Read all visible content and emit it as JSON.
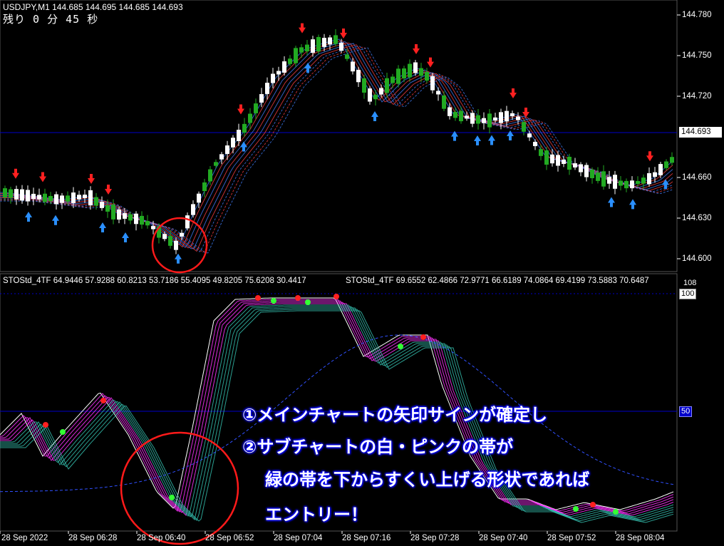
{
  "header": {
    "symbol_text": "USDJPY,M1  144.685 144.695 144.685 144.693",
    "remaining_text": "残り 0 分 45 秒"
  },
  "price_axis": {
    "ticks": [
      "144.780",
      "144.750",
      "144.720",
      "144.693",
      "144.660",
      "144.630",
      "144.600"
    ],
    "current_price": "144.693"
  },
  "indicator": {
    "label_left": "STOStd_4TF 64.9446 57.9288 60.8213 53.7186 55.4095 49.8205 75.6208 30.4417",
    "label_right": "STOStd_4TF 69.6552 62.4866 72.9771 66.6189 74.0864 69.4199 73.5883 70.6487",
    "level_top": "108",
    "level_100": "100",
    "level_50": "50"
  },
  "time_axis": {
    "labels": [
      "28 Sep 2022",
      "28 Sep 06:28",
      "28 Sep 06:40",
      "28 Sep 06:52",
      "28 Sep 07:04",
      "28 Sep 07:16",
      "28 Sep 07:28",
      "28 Sep 07:40",
      "28 Sep 07:52",
      "28 Sep 08:04"
    ]
  },
  "annotations": {
    "line1": "①メインチャートの矢印サインが確定し",
    "line2": "②サブチャートの白・ピンクの帯が",
    "line3": "緑の帯を下からすくい上げる形状であれば",
    "line4": "エントリー！"
  },
  "colors": {
    "background": "#000000",
    "bull_candle": "#22aa22",
    "bear_candle": "#ffffff",
    "sell_arrow": "#ff2020",
    "buy_arrow": "#2a8fff",
    "grid_line": "#0000c8",
    "highlight_circle": "#ff1a1a",
    "oscillator_fast": "#ff33ff",
    "oscillator_slow": "#33bbaa"
  }
}
